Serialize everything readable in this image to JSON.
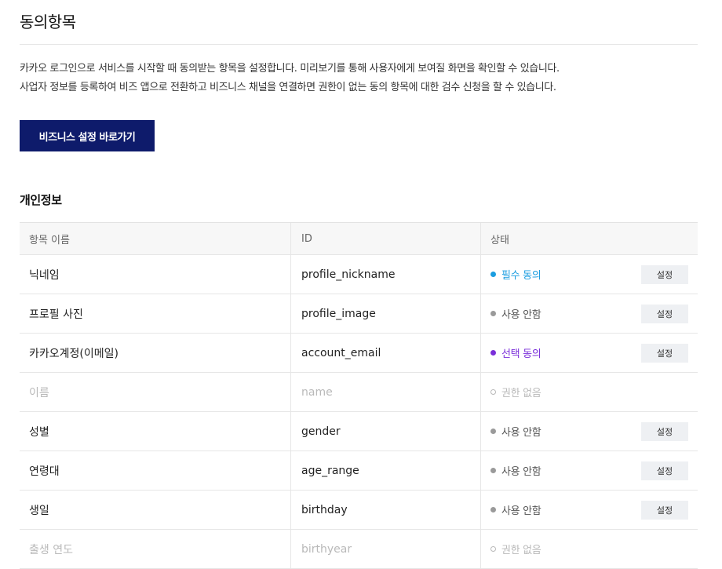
{
  "header": {
    "title": "동의항목"
  },
  "description": {
    "line1": "카카오 로그인으로 서비스를 시작할 때 동의받는 항목을 설정합니다. 미리보기를 통해 사용자에게 보여질 화면을 확인할 수 있습니다.",
    "line2": "사업자 정보를 등록하여 비즈 앱으로 전환하고 비즈니스 채널을 연결하면 권한이 없는 동의 항목에 대한 검수 신청을 할 수 있습니다."
  },
  "business_button_label": "비즈니스 설정 바로가기",
  "section": {
    "title": "개인정보"
  },
  "table": {
    "headers": {
      "name": "항목 이름",
      "id": "ID",
      "status": "상태"
    },
    "rows": [
      {
        "name": "닉네임",
        "id": "profile_nickname",
        "status": "필수 동의",
        "status_color": "#1a9de0",
        "dot_style": "filled",
        "disabled": false,
        "button": "설정"
      },
      {
        "name": "프로필 사진",
        "id": "profile_image",
        "status": "사용 안함",
        "status_color": "#555555",
        "dot_color": "#9a9a9a",
        "dot_style": "filled",
        "disabled": false,
        "button": "설정"
      },
      {
        "name": "카카오계정(이메일)",
        "id": "account_email",
        "status": "선택 동의",
        "status_color": "#7a2fd9",
        "dot_style": "filled",
        "disabled": false,
        "button": "설정"
      },
      {
        "name": "이름",
        "id": "name",
        "status": "권한 없음",
        "status_color": "#b9b9b9",
        "dot_style": "outline",
        "disabled": true,
        "button": ""
      },
      {
        "name": "성별",
        "id": "gender",
        "status": "사용 안함",
        "status_color": "#555555",
        "dot_color": "#9a9a9a",
        "dot_style": "filled",
        "disabled": false,
        "button": "설정"
      },
      {
        "name": "연령대",
        "id": "age_range",
        "status": "사용 안함",
        "status_color": "#555555",
        "dot_color": "#9a9a9a",
        "dot_style": "filled",
        "disabled": false,
        "button": "설정"
      },
      {
        "name": "생일",
        "id": "birthday",
        "status": "사용 안함",
        "status_color": "#555555",
        "dot_color": "#9a9a9a",
        "dot_style": "filled",
        "disabled": false,
        "button": "설정"
      },
      {
        "name": "출생 연도",
        "id": "birthyear",
        "status": "권한 없음",
        "status_color": "#b9b9b9",
        "dot_style": "outline",
        "disabled": true,
        "button": ""
      }
    ]
  }
}
